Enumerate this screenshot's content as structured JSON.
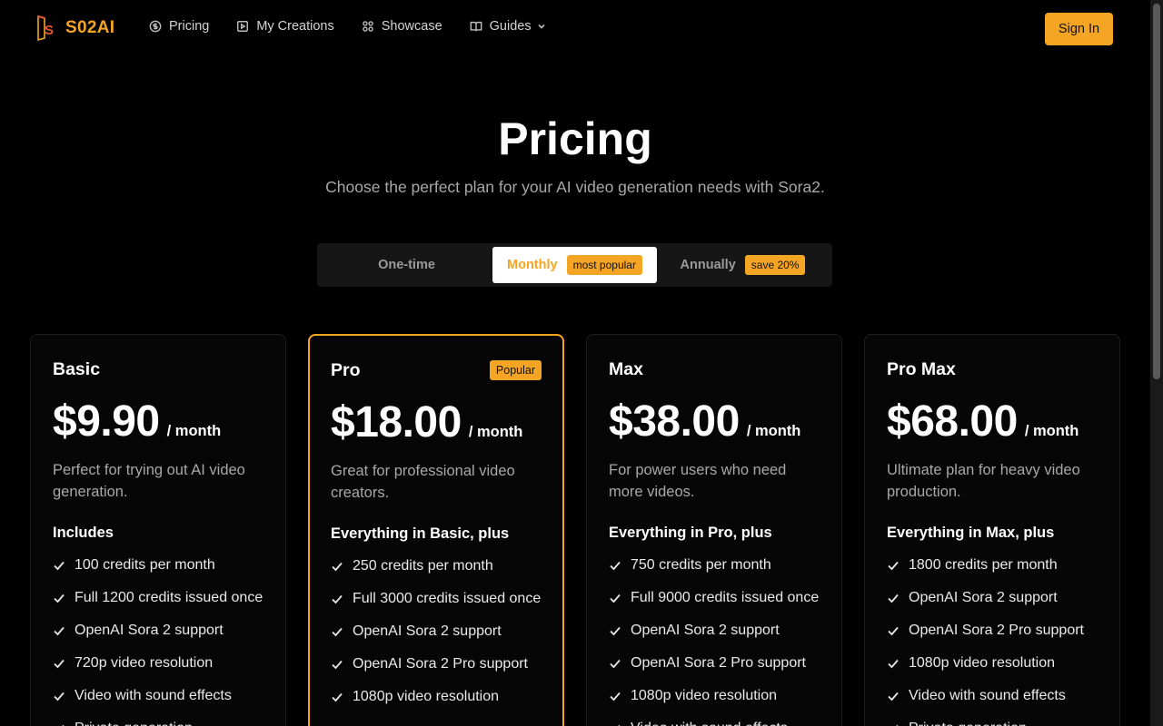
{
  "brand": {
    "name": "S02AI",
    "accent": "#f5a524"
  },
  "nav": [
    {
      "label": "Pricing",
      "icon": "dollar-circle-icon"
    },
    {
      "label": "My Creations",
      "icon": "play-square-icon"
    },
    {
      "label": "Showcase",
      "icon": "grid-icon"
    },
    {
      "label": "Guides",
      "icon": "book-icon"
    }
  ],
  "header": {
    "signin_label": "Sign In"
  },
  "hero": {
    "title": "Pricing",
    "subtitle": "Choose the perfect plan for your AI video generation needs with Sora2."
  },
  "billing": {
    "selected": "Monthly",
    "options": [
      {
        "label": "One-time",
        "badge": ""
      },
      {
        "label": "Monthly",
        "badge": "most popular"
      },
      {
        "label": "Annually",
        "badge": "save 20%"
      }
    ]
  },
  "plans": [
    {
      "name": "Basic",
      "badge": "",
      "price": "$9.90",
      "period": "/ month",
      "description": "Perfect for trying out AI video generation.",
      "includes_title": "Includes",
      "features": [
        "100 credits per month",
        "Full 1200 credits issued once",
        "OpenAI Sora 2 support",
        "720p video resolution",
        "Video with sound effects",
        "Private generation"
      ]
    },
    {
      "name": "Pro",
      "badge": "Popular",
      "price": "$18.00",
      "period": "/ month",
      "description": "Great for professional video creators.",
      "includes_title": "Everything in Basic, plus",
      "features": [
        "250 credits per month",
        "Full 3000 credits issued once",
        "OpenAI Sora 2 support",
        "OpenAI Sora 2 Pro support",
        "1080p video resolution"
      ]
    },
    {
      "name": "Max",
      "badge": "",
      "price": "$38.00",
      "period": "/ month",
      "description": "For power users who need more videos.",
      "includes_title": "Everything in Pro, plus",
      "features": [
        "750 credits per month",
        "Full 9000 credits issued once",
        "OpenAI Sora 2 support",
        "OpenAI Sora 2 Pro support",
        "1080p video resolution",
        "Video with sound effects"
      ]
    },
    {
      "name": "Pro Max",
      "badge": "",
      "price": "$68.00",
      "period": "/ month",
      "description": "Ultimate plan for heavy video production.",
      "includes_title": "Everything in Max, plus",
      "features": [
        "1800 credits per month",
        "OpenAI Sora 2 support",
        "OpenAI Sora 2 Pro support",
        "1080p video resolution",
        "Video with sound effects",
        "Private generation"
      ]
    }
  ]
}
